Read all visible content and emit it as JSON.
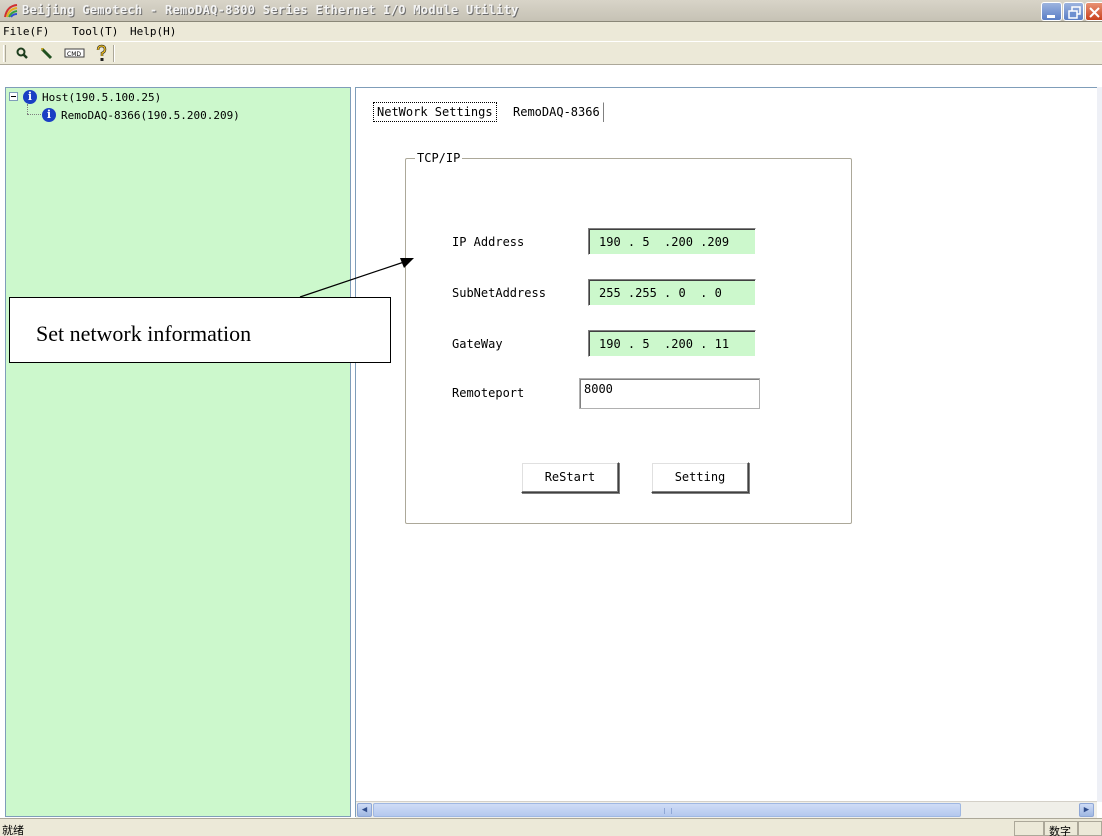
{
  "window": {
    "title": "Beijing Gemotech - RemoDAQ-8300 Series Ethernet I/O Module Utility",
    "app_icon": "rainbow-app-icon",
    "controls": [
      "minimize-icon",
      "restore-icon",
      "close-icon"
    ]
  },
  "menu": {
    "items": [
      {
        "label": "File(F)"
      },
      {
        "label": "Tool(T)"
      },
      {
        "label": "Help(H)"
      }
    ]
  },
  "toolbar": {
    "buttons": [
      {
        "icon": "search-icon"
      },
      {
        "icon": "pencil-icon"
      },
      {
        "icon": "cmd-icon",
        "label": "CMD"
      },
      {
        "icon": "help-question-icon"
      }
    ]
  },
  "tree": {
    "root": {
      "label": "Host(190.5.100.25)",
      "icon": "info-icon"
    },
    "child": {
      "label": "RemoDAQ-8366(190.5.200.209)",
      "icon": "info-icon"
    }
  },
  "tabs": [
    {
      "label": "NetWork Settings",
      "active": true
    },
    {
      "label": "RemoDAQ-8366",
      "active": false
    }
  ],
  "tcpip": {
    "legend": "TCP/IP",
    "ip_label": "IP Address",
    "ip_value": "190 . 5  .200 .209",
    "subnet_label": "SubNetAddress",
    "subnet_value": "255 .255 . 0  . 0",
    "gateway_label": "GateWay",
    "gateway_value": "190 . 5  .200 . 11",
    "port_label": "Remoteport",
    "port_value": "8000",
    "restart_label": "ReStart",
    "setting_label": "Setting"
  },
  "callout": {
    "text": "Set network information"
  },
  "status": {
    "left": "就绪",
    "panes": [
      "",
      "数字",
      ""
    ]
  }
}
